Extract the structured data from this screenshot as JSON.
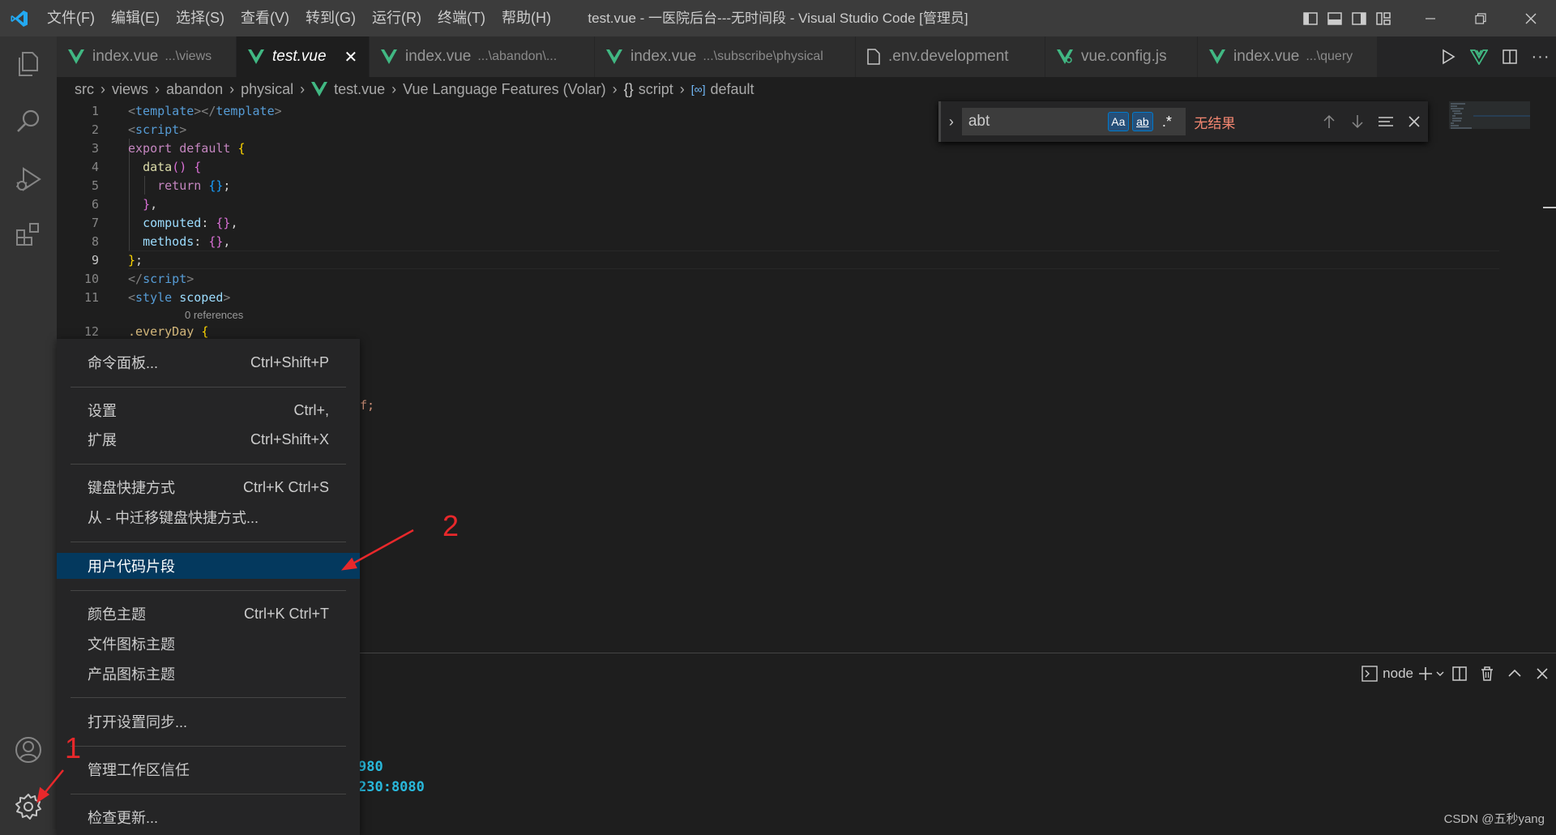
{
  "titlebar": {
    "menus": [
      "文件(F)",
      "编辑(E)",
      "选择(S)",
      "查看(V)",
      "转到(G)",
      "运行(R)",
      "终端(T)",
      "帮助(H)"
    ],
    "title": "test.vue - 一医院后台---无时间段 - Visual Studio Code [管理员]"
  },
  "tabs": [
    {
      "label": "index.vue",
      "sub": "...\\views"
    },
    {
      "label": "test.vue",
      "sub": ""
    },
    {
      "label": "index.vue",
      "sub": "...\\abandon\\..."
    },
    {
      "label": "index.vue",
      "sub": "...\\subscribe\\physical"
    },
    {
      "label": ".env.development",
      "sub": ""
    },
    {
      "label": "vue.config.js",
      "sub": ""
    },
    {
      "label": "index.vue",
      "sub": "...\\query"
    }
  ],
  "breadcrumb": {
    "items": [
      "src",
      "views",
      "abandon",
      "physical",
      "test.vue",
      "Vue Language Features (Volar)",
      "script",
      "default"
    ]
  },
  "editor": {
    "line_numbers": [
      "1",
      "2",
      "3",
      "4",
      "5",
      "6",
      "7",
      "8",
      "9",
      "10",
      "11",
      "12"
    ],
    "references_label": "0 references",
    "partial_text_1": "f;",
    "partial_text_2": "980",
    "partial_text_3": "230:8080"
  },
  "find": {
    "query": "abt",
    "match_case": "Aa",
    "whole_word": "ab",
    "regex": ".*",
    "result": "无结果"
  },
  "panel": {
    "terminal_name": "node"
  },
  "context_menu": {
    "items": [
      {
        "label": "命令面板...",
        "shortcut": "Ctrl+Shift+P"
      },
      {
        "label": "设置",
        "shortcut": "Ctrl+,"
      },
      {
        "label": "扩展",
        "shortcut": "Ctrl+Shift+X"
      },
      {
        "label": "键盘快捷方式",
        "shortcut": "Ctrl+K Ctrl+S"
      },
      {
        "label": "从 - 中迁移键盘快捷方式...",
        "shortcut": ""
      },
      {
        "label": "用户代码片段",
        "shortcut": ""
      },
      {
        "label": "颜色主题",
        "shortcut": "Ctrl+K Ctrl+T"
      },
      {
        "label": "文件图标主题",
        "shortcut": ""
      },
      {
        "label": "产品图标主题",
        "shortcut": ""
      },
      {
        "label": "打开设置同步...",
        "shortcut": ""
      },
      {
        "label": "管理工作区信任",
        "shortcut": ""
      },
      {
        "label": "检查更新...",
        "shortcut": ""
      }
    ]
  },
  "annotations": {
    "one": "1",
    "two": "2"
  },
  "watermark": "CSDN @五秒yang",
  "colors": {
    "accent": "#007acc",
    "highlight": "#04395e",
    "vue_green": "#41b883",
    "annotation_red": "#e8282b"
  }
}
